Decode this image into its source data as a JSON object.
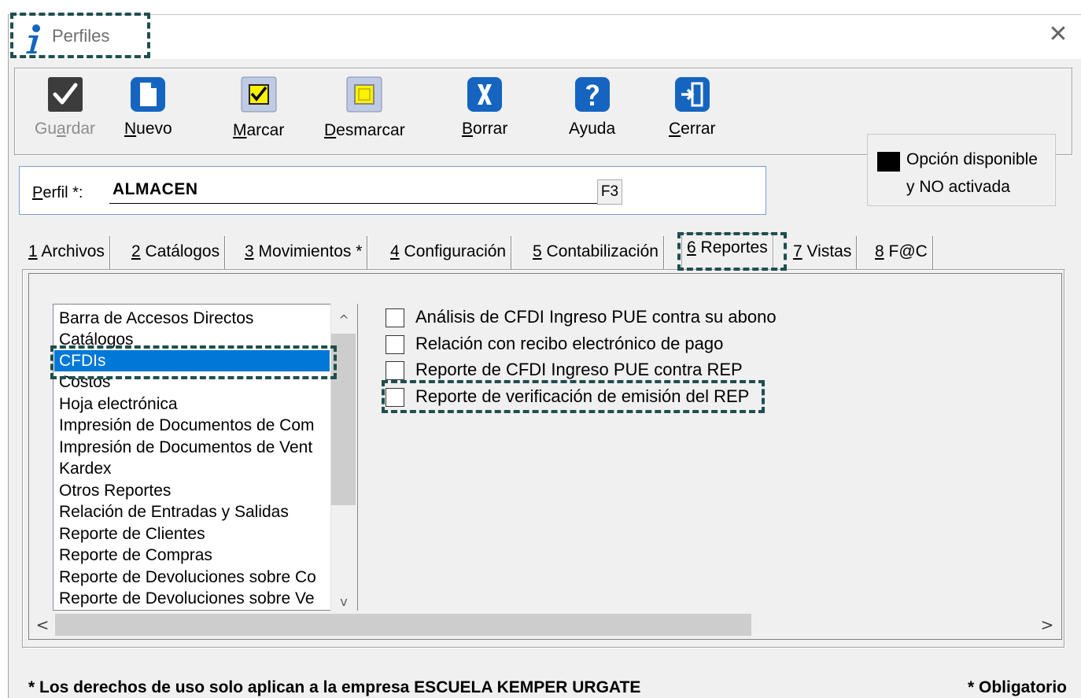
{
  "window": {
    "title": "Perfiles",
    "close_glyph": "✕"
  },
  "toolbar": {
    "buttons": [
      {
        "id": "guardar",
        "label_pre": "Gu",
        "label_key": "a",
        "label_post": "rdar",
        "icon": "check-icon",
        "enabled": false
      },
      {
        "id": "nuevo",
        "label_pre": "",
        "label_key": "N",
        "label_post": "uevo",
        "icon": "new-document-icon",
        "enabled": true
      },
      {
        "id": "marcar",
        "label_pre": "",
        "label_key": "M",
        "label_post": "arcar",
        "icon": "checked-box-icon",
        "enabled": true
      },
      {
        "id": "desmarcar",
        "label_pre": "",
        "label_key": "D",
        "label_post": "esmarcar",
        "icon": "unchecked-box-icon",
        "enabled": true
      },
      {
        "id": "borrar",
        "label_pre": "",
        "label_key": "B",
        "label_post": "orrar",
        "icon": "x-delete-icon",
        "enabled": true
      },
      {
        "id": "ayuda",
        "label_pre": "Ayuda",
        "label_key": "",
        "label_post": "",
        "icon": "help-icon",
        "enabled": true
      },
      {
        "id": "cerrar",
        "label_pre": "",
        "label_key": "C",
        "label_post": "errar",
        "icon": "exit-door-icon",
        "enabled": true
      }
    ]
  },
  "legend": {
    "line1": "Opción disponible",
    "line2": "y NO activada"
  },
  "perfil": {
    "label_key": "P",
    "label_rest": "erfil *:",
    "value": "ALMACEN",
    "lookup_key": "F3"
  },
  "tabs": [
    {
      "key": "1",
      "label": " Archivos",
      "active": false
    },
    {
      "key": "2",
      "label": " Catálogos",
      "active": false
    },
    {
      "key": "3",
      "label": " Movimientos *",
      "active": false
    },
    {
      "key": "4",
      "label": " Configuración",
      "active": false
    },
    {
      "key": "5",
      "label": " Contabilización",
      "active": false
    },
    {
      "key": "6",
      "label": " Reportes",
      "active": true
    },
    {
      "key": "7",
      "label": " Vistas",
      "active": false
    },
    {
      "key": "8",
      "label": " F@C",
      "active": false
    }
  ],
  "report_categories": [
    "Barra de Accesos Directos",
    "Catálogos",
    "CFDIs",
    "Costos",
    "Hoja electrónica",
    "Impresión de Documentos de Com",
    "Impresión de Documentos de Vent",
    "Kardex",
    "Otros Reportes",
    "Relación de Entradas y Salidas",
    "Reporte de Clientes",
    "Reporte de Compras",
    "Reporte de Devoluciones sobre Co",
    "Reporte de Devoluciones sobre Ve"
  ],
  "selected_category": "CFDIs",
  "report_options": [
    {
      "label": "Análisis de CFDI Ingreso PUE contra su abono",
      "checked": false
    },
    {
      "label": "Relación con recibo electrónico de pago",
      "checked": false
    },
    {
      "label": "Reporte de CFDI Ingreso PUE contra REP",
      "checked": false
    },
    {
      "label": "Reporte de verificación de emisión del REP",
      "checked": false
    }
  ],
  "footer": {
    "rights_note": "* Los derechos de uso solo aplican a la empresa ESCUELA KEMPER URGATE",
    "required_note": "* Obligatorio"
  },
  "colors": {
    "highlight_dash": "#1f4f4d",
    "selection": "#0078d7",
    "icon_blue": "#1565c0"
  }
}
